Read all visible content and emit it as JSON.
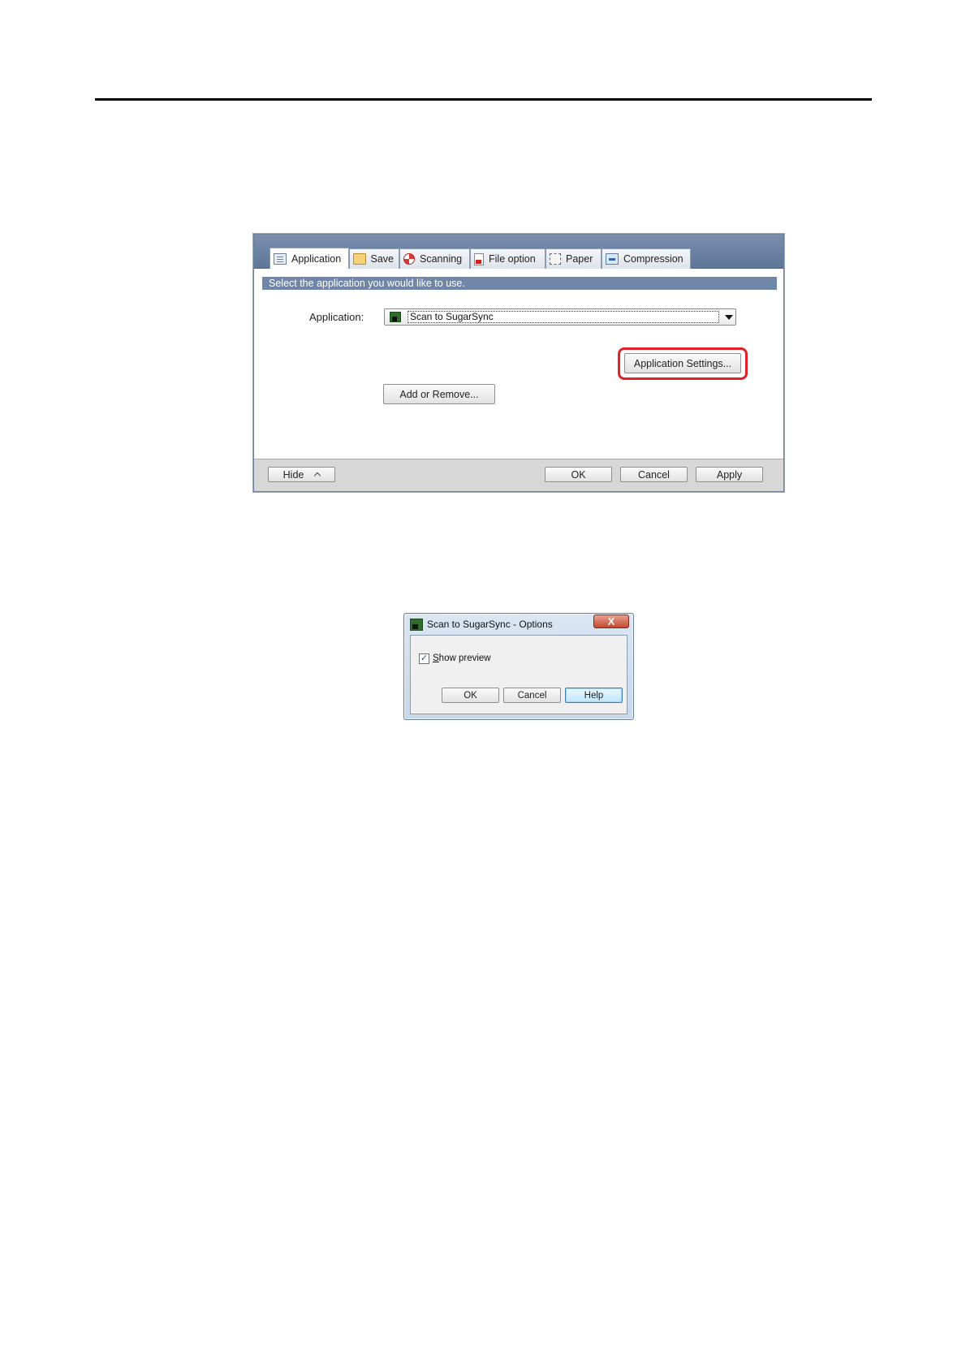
{
  "main_window": {
    "tabs": [
      {
        "label": "Application",
        "icon": "application-tab-icon"
      },
      {
        "label": "Save",
        "icon": "folder-icon"
      },
      {
        "label": "Scanning",
        "icon": "scanning-icon"
      },
      {
        "label": "File option",
        "icon": "pdf-file-icon"
      },
      {
        "label": "Paper",
        "icon": "paper-icon"
      },
      {
        "label": "Compression",
        "icon": "compression-icon"
      }
    ],
    "active_tab": "Application",
    "instruction": "Select the application you would like to use.",
    "application_label": "Application:",
    "application_value": "Scan to SugarSync",
    "application_settings_button": "Application Settings...",
    "add_remove_button": "Add or Remove...",
    "footer": {
      "hide_button": "Hide",
      "ok_button": "OK",
      "cancel_button": "Cancel",
      "apply_button": "Apply"
    },
    "highlight_color": "#e0202a"
  },
  "options_dialog": {
    "title": "Scan to SugarSync - Options",
    "close_symbol": "X",
    "show_preview_label_first": "S",
    "show_preview_label_rest": "how preview",
    "show_preview_checked": true,
    "check_mark": "✓",
    "ok_button": "OK",
    "cancel_button": "Cancel",
    "help_button": "Help"
  }
}
